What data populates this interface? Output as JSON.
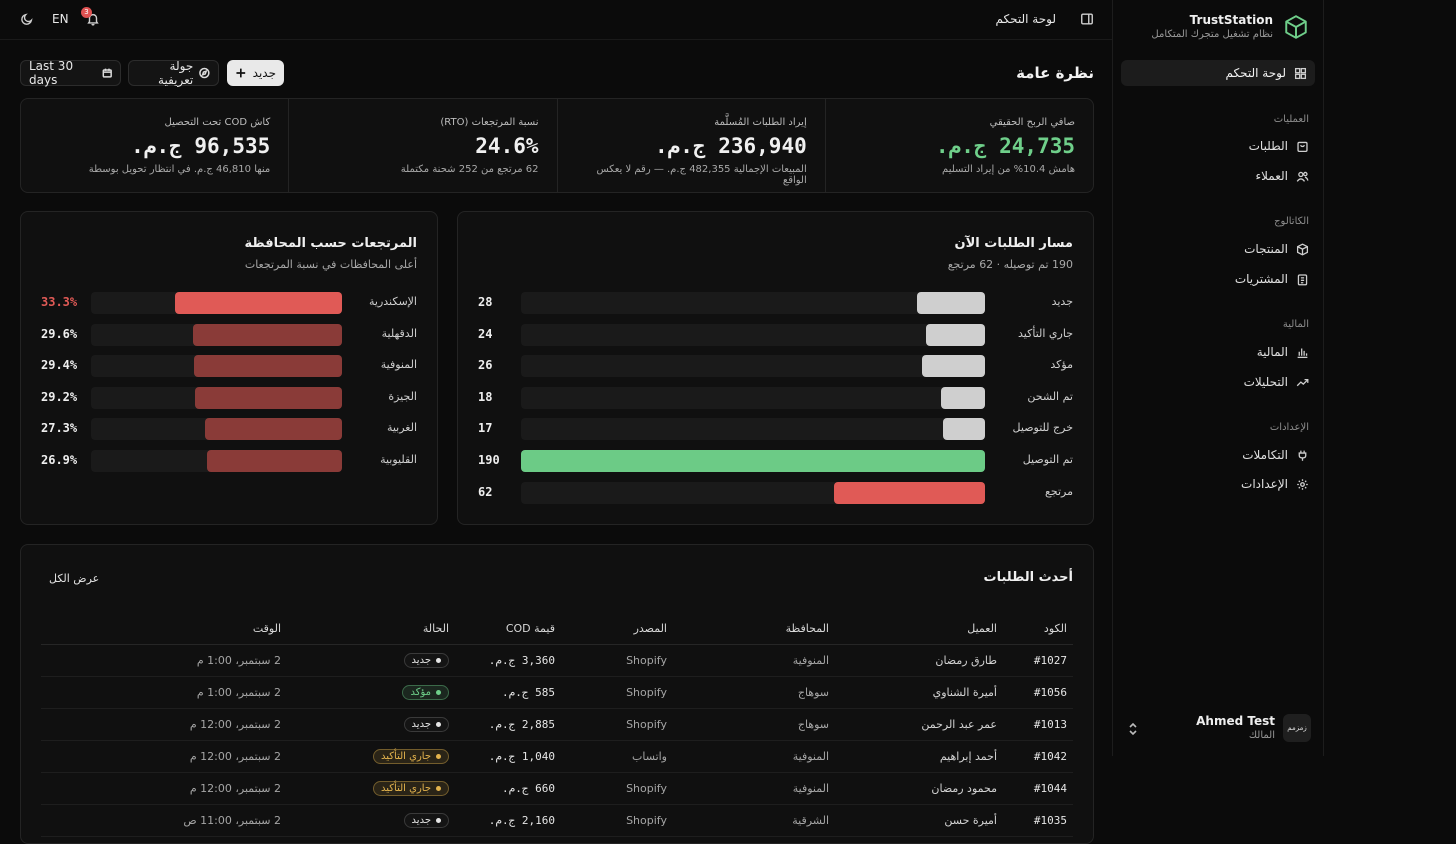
{
  "brand": {
    "name": "TrustStation",
    "subtitle": "نظام تشغيل متجرك المتكامل"
  },
  "sidebar": {
    "active": "لوحة التحكم",
    "groups": [
      {
        "label": "العمليات",
        "items": [
          "الطلبات",
          "العملاء"
        ]
      },
      {
        "label": "الكاتالوج",
        "items": [
          "المنتجات",
          "المشتريات"
        ]
      },
      {
        "label": "المالية",
        "items": [
          "المالية",
          "التحليلات"
        ]
      },
      {
        "label": "الإعدادات",
        "items": [
          "التكاملات",
          "الإعدادات"
        ]
      }
    ],
    "user": {
      "name": "Ahmed Test",
      "role": "المالك",
      "avatar": "زمزمم"
    }
  },
  "topbar": {
    "title": "لوحة التحكم",
    "lang": "EN",
    "notif_count": "3"
  },
  "header": {
    "title": "نظرة عامة",
    "new_btn": "جديد",
    "tour_btn": "جولة تعريفية",
    "range_btn": "Last 30 days"
  },
  "kpis": [
    {
      "label": "صافي الربح الحقيقي",
      "value": "24,735 ج.م.",
      "sub": "هامش 10.4% من إيراد التسليم",
      "accent": "#6fcf8a"
    },
    {
      "label": "إيراد الطلبات المُسلَّمة",
      "value": "236,940 ج.م.",
      "sub": "المبيعات الإجمالية 482,355 ج.م. — رقم لا يعكس الواقع"
    },
    {
      "label": "نسبة المرتجعات (RTO)",
      "value": "24.6%",
      "sub": "62 مرتجع من 252 شحنة مكتملة"
    },
    {
      "label": "كاش COD تحت التحصيل",
      "value": "96,535 ج.م.",
      "sub": "منها 46,810 ج.م. في انتظار تحويل بوسطة"
    }
  ],
  "pipeline": {
    "title": "مسار الطلبات الآن",
    "subtitle": "190 تم توصيله · 62 مرتجع",
    "max": 190,
    "rows": [
      {
        "label": "جديد",
        "value": 28,
        "color": "#cfcfcf"
      },
      {
        "label": "جاري التأكيد",
        "value": 24,
        "color": "#cfcfcf"
      },
      {
        "label": "مؤكد",
        "value": 26,
        "color": "#cfcfcf"
      },
      {
        "label": "تم الشحن",
        "value": 18,
        "color": "#cfcfcf"
      },
      {
        "label": "خرج للتوصيل",
        "value": 17,
        "color": "#cfcfcf"
      },
      {
        "label": "تم التوصيل",
        "value": 190,
        "color": "#6ccb86"
      },
      {
        "label": "مرتجع",
        "value": 62,
        "color": "#e05a56"
      }
    ]
  },
  "returns": {
    "title": "المرتجعات حسب المحافظة",
    "subtitle": "أعلى المحافظات في نسبة المرتجعات",
    "max_pct": 50,
    "rows": [
      {
        "label": "الإسكندرية",
        "pct": 33.3,
        "text": "33.3%",
        "color": "#e05a56",
        "highlight": true
      },
      {
        "label": "الدقهلية",
        "pct": 29.6,
        "text": "29.6%",
        "color": "#8a3b38"
      },
      {
        "label": "المنوفية",
        "pct": 29.4,
        "text": "29.4%",
        "color": "#8a3b38"
      },
      {
        "label": "الجيزة",
        "pct": 29.2,
        "text": "29.2%",
        "color": "#8a3b38"
      },
      {
        "label": "الغربية",
        "pct": 27.3,
        "text": "27.3%",
        "color": "#8a3b38"
      },
      {
        "label": "القليوبية",
        "pct": 26.9,
        "text": "26.9%",
        "color": "#8a3b38"
      }
    ]
  },
  "orders": {
    "title": "أحدث الطلبات",
    "view_all": "عرض الكل",
    "columns": [
      "الكود",
      "العميل",
      "المحافظة",
      "المصدر",
      "قيمة COD",
      "الحالة",
      "الوقت"
    ],
    "rows": [
      {
        "code": "#1027",
        "customer": "طارق رمضان",
        "gov": "المنوفية",
        "source": "Shopify",
        "cod": "3,360 ج.م.",
        "status": "جديد",
        "status_color": "#e6e6e6",
        "time": "2 سبتمبر، 1:00 م"
      },
      {
        "code": "#1056",
        "customer": "أميرة الشناوي",
        "gov": "سوهاج",
        "source": "Shopify",
        "cod": "585 ج.م.",
        "status": "مؤكد",
        "status_color": "#6fcf8a",
        "time": "2 سبتمبر، 1:00 م"
      },
      {
        "code": "#1013",
        "customer": "عمر عبد الرحمن",
        "gov": "سوهاج",
        "source": "Shopify",
        "cod": "2,885 ج.م.",
        "status": "جديد",
        "status_color": "#e6e6e6",
        "time": "2 سبتمبر، 12:00 م"
      },
      {
        "code": "#1042",
        "customer": "أحمد إبراهيم",
        "gov": "المنوفية",
        "source": "واتساب",
        "cod": "1,040 ج.م.",
        "status": "جاري التأكيد",
        "status_color": "#e3b34d",
        "time": "2 سبتمبر، 12:00 م"
      },
      {
        "code": "#1044",
        "customer": "محمود رمضان",
        "gov": "المنوفية",
        "source": "Shopify",
        "cod": "660 ج.م.",
        "status": "جاري التأكيد",
        "status_color": "#e3b34d",
        "time": "2 سبتمبر، 12:00 م"
      },
      {
        "code": "#1035",
        "customer": "أميرة حسن",
        "gov": "الشرقية",
        "source": "Shopify",
        "cod": "2,160 ج.م.",
        "status": "جديد",
        "status_color": "#e6e6e6",
        "time": "2 سبتمبر، 11:00 ص"
      }
    ]
  }
}
